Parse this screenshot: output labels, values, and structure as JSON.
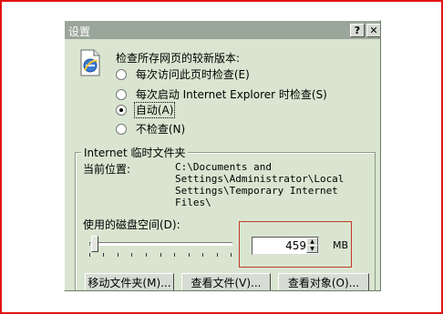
{
  "dialog": {
    "title": "设置",
    "help_button": "?",
    "close_button": "✕"
  },
  "check_new_versions": {
    "label": "检查所存网页的较新版本:",
    "options": [
      {
        "label": "每次访问此页时检查(E)",
        "selected": false
      },
      {
        "label": "每次启动 Internet Explorer 时检查(S)",
        "selected": false
      },
      {
        "label": "自动(A)",
        "selected": true
      },
      {
        "label": "不检查(N)",
        "selected": false
      }
    ]
  },
  "temp_files": {
    "group_title": "Internet 临时文件夹",
    "location_label": "当前位置:",
    "location_path": "C:\\Documents and\nSettings\\Administrator\\Local\nSettings\\Temporary Internet\nFiles\\",
    "disk_space_label": "使用的磁盘空间(D):",
    "disk_space_value": "459",
    "disk_space_unit": "MB"
  },
  "buttons": {
    "move_folder": "移动文件夹(M)...",
    "view_files": "查看文件(V)...",
    "view_objects": "查看对象(O)..."
  },
  "colors": {
    "dialog_bg": "#d9e5d0",
    "title_bar": "#9aa69a",
    "highlight_border": "#c0392b",
    "outer_border": "#e01515"
  }
}
